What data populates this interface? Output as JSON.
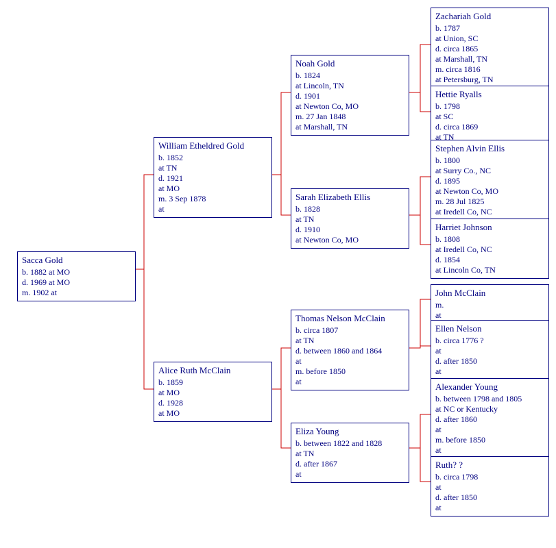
{
  "gen1": {
    "p1": {
      "name": "Sacca Gold",
      "l1": "b.  1882 at MO",
      "l2": "d.  1969 at MO",
      "l3": "m.  1902 at"
    }
  },
  "gen2": {
    "father": {
      "name": "William Etheldred Gold",
      "l1": "b.  1852",
      "l2": "at TN",
      "l3": "d.  1921",
      "l4": "at MO",
      "l5": "m.  3 Sep 1878",
      "l6": "at"
    },
    "mother": {
      "name": "Alice Ruth McClain",
      "l1": "b.  1859",
      "l2": "at MO",
      "l3": "d.  1928",
      "l4": "at MO"
    }
  },
  "gen3": {
    "pf": {
      "name": "Noah Gold",
      "l1": "b.  1824",
      "l2": "at Lincoln, TN",
      "l3": "d.  1901",
      "l4": "at Newton Co, MO",
      "l5": "m.  27 Jan 1848",
      "l6": "at Marshall, TN"
    },
    "pm": {
      "name": "Sarah Elizabeth Ellis",
      "l1": "b.  1828",
      "l2": "at TN",
      "l3": "d.  1910",
      "l4": "at Newton Co, MO"
    },
    "mf": {
      "name": "Thomas Nelson McClain",
      "l1": "b.  circa 1807",
      "l2": "at TN",
      "l3": "d.  between 1860 and 1864",
      "l4": "at",
      "l5": "m.  before 1850",
      "l6": "at"
    },
    "mm": {
      "name": "Eliza Young",
      "l1": "b.  between 1822 and 1828",
      "l2": "at TN",
      "l3": "d.  after 1867",
      "l4": "at"
    }
  },
  "gen4": {
    "p1": {
      "name": "Zachariah Gold",
      "l1": "b.  1787",
      "l2": "at Union, SC",
      "l3": "d.  circa 1865",
      "l4": "at Marshall, TN",
      "l5": "m.  circa 1816",
      "l6": "at Petersburg, TN"
    },
    "p2": {
      "name": "Hettie Ryalls",
      "l1": "b.  1798",
      "l2": "at SC",
      "l3": "d.  circa 1869",
      "l4": "at TN"
    },
    "p3": {
      "name": "Stephen Alvin Ellis",
      "l1": "b.  1800",
      "l2": "at Surry Co., NC",
      "l3": "d.  1895",
      "l4": "at Newton Co, MO",
      "l5": "m.  28 Jul 1825",
      "l6": "at Iredell Co, NC"
    },
    "p4": {
      "name": "Harriet Johnson",
      "l1": "b.  1808",
      "l2": "at Iredell Co, NC",
      "l3": "d.  1854",
      "l4": "at Lincoln Co, TN"
    },
    "p5": {
      "name": "John McClain",
      "l1": "m.",
      "l2": "at"
    },
    "p6": {
      "name": "Ellen Nelson",
      "l1": "b.  circa 1776 ?",
      "l2": "at",
      "l3": "d.  after 1850",
      "l4": "at"
    },
    "p7": {
      "name": "Alexander Young",
      "l1": "b.  between 1798 and 1805",
      "l2": "at NC or Kentucky",
      "l3": "d.  after 1860",
      "l4": "at",
      "l5": "m.  before 1850",
      "l6": "at"
    },
    "p8": {
      "name": "Ruth? ?",
      "l1": "b.  circa 1798",
      "l2": "at",
      "l3": "d.  after 1850",
      "l4": "at"
    }
  }
}
